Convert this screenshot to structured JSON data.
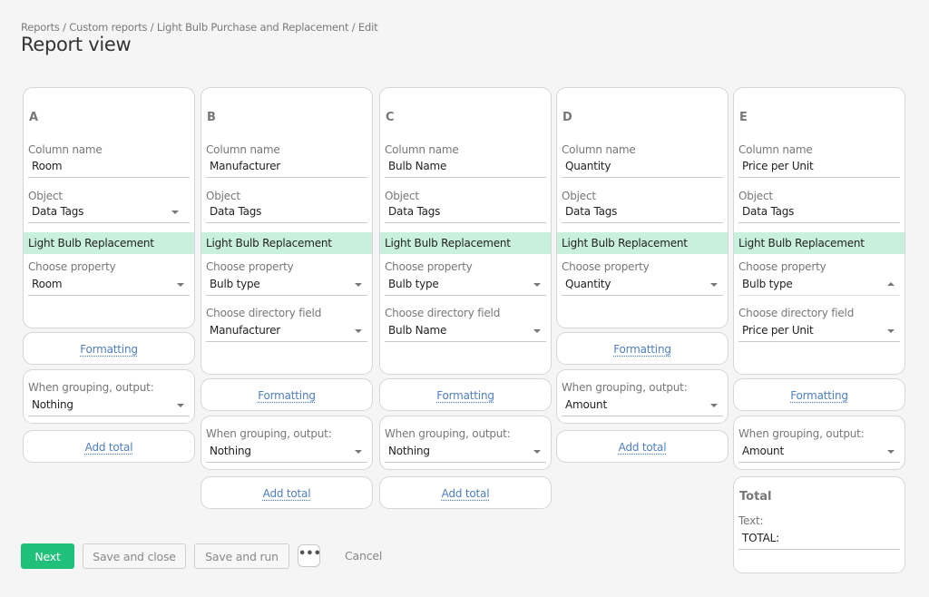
{
  "breadcrumb": "Reports / Custom reports / Light Bulb Purchase and Replacement / Edit",
  "title": "Report view",
  "labels": {
    "column_name": "Column name",
    "object": "Object",
    "choose_property": "Choose property",
    "choose_directory_field": "Choose directory field",
    "formatting": "Formatting",
    "grouping": "When grouping, output:",
    "add_total": "Add total"
  },
  "columns": [
    {
      "letter": "A",
      "name": "Room",
      "object": "Data Tags",
      "tag": "Light Bulb Replacement",
      "property": "Room",
      "grouping": "Nothing"
    },
    {
      "letter": "B",
      "name": "Manufacturer",
      "object": "Data Tags",
      "tag": "Light Bulb Replacement",
      "property": "Bulb type",
      "directory_field": "Manufacturer",
      "grouping": "Nothing"
    },
    {
      "letter": "C",
      "name": "Bulb Name",
      "object": "Data Tags",
      "tag": "Light Bulb Replacement",
      "property": "Bulb type",
      "directory_field": "Bulb Name",
      "grouping": "Nothing"
    },
    {
      "letter": "D",
      "name": "Quantity",
      "object": "Data Tags",
      "tag": "Light Bulb Replacement",
      "property": "Quantity",
      "grouping": "Amount"
    },
    {
      "letter": "E",
      "name": "Price per Unit",
      "object": "Data Tags",
      "tag": "Light Bulb Replacement",
      "property": "Bulb type",
      "directory_field": "Price per Unit",
      "grouping": "Amount"
    }
  ],
  "total": {
    "title": "Total",
    "text_label": "Text:",
    "text_value": "TOTAL:"
  },
  "actions": {
    "next": "Next",
    "save_close": "Save and close",
    "save_run": "Save and run",
    "more": "•••",
    "cancel": "Cancel"
  }
}
